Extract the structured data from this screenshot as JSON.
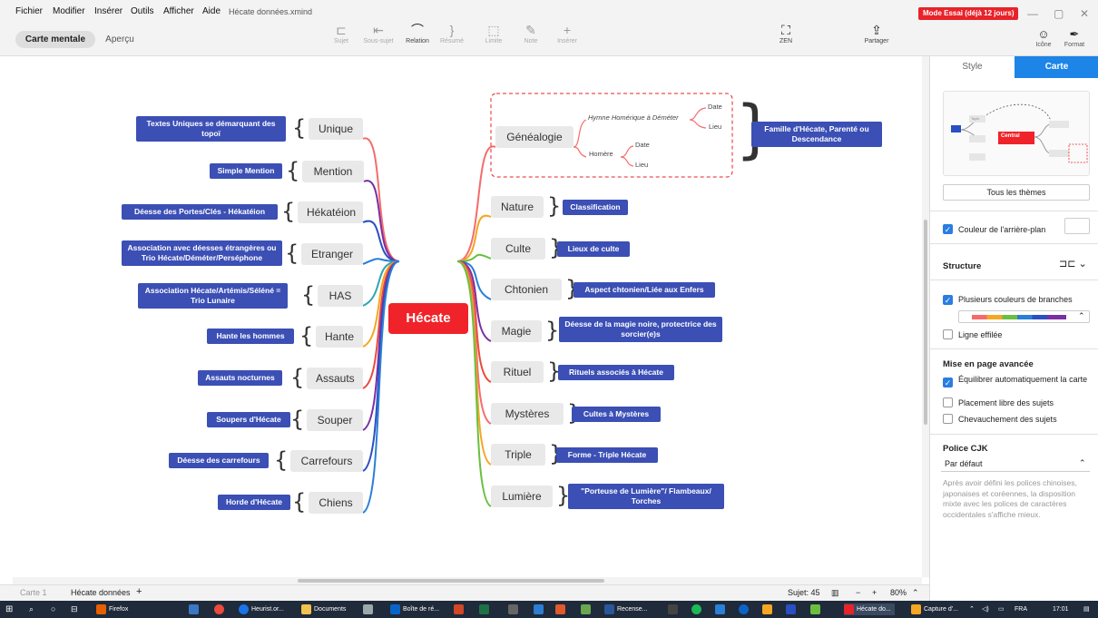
{
  "menubar": {
    "items": [
      "Fichier",
      "Modifier",
      "Insérer",
      "Outils",
      "Afficher",
      "Aide"
    ],
    "filename": "Hécate données.xmind",
    "trial_badge": "Mode Essai (déjà 12 jours)"
  },
  "view_tabs": {
    "mindmap": "Carte mentale",
    "preview": "Aperçu"
  },
  "toolbar": {
    "subject": "Sujet",
    "subsubject": "Sous-sujet",
    "relation": "Relation",
    "summary": "Résumé",
    "boundary": "Limite",
    "note": "Note",
    "insert": "Insérer",
    "zen": "ZEN",
    "share": "Partager",
    "icon_tab": "Icône",
    "format_tab": "Format"
  },
  "map": {
    "central": "Hécate",
    "left_branches": [
      {
        "topic": "Unique",
        "label": "Textes Uniques se démarquant des topoï",
        "color": "#f56b6b"
      },
      {
        "topic": "Mention",
        "label": "Simple Mention",
        "color": "#7b2fa3"
      },
      {
        "topic": "Hékatéion",
        "label": "Déesse des Portes/Clés - Hékatéion",
        "color": "#2a4fc2"
      },
      {
        "topic": "Etranger",
        "label": "Association avec déesses étrangères ou Trio Hécate/Déméter/Perséphone",
        "color": "#2a7fd6"
      },
      {
        "topic": "HAS",
        "label": "Association Hécate/Artémis/Séléné = Trio Lunaire",
        "color": "#2fa6b8"
      },
      {
        "topic": "Hante",
        "label": "Hante les hommes",
        "color": "#f5a623"
      },
      {
        "topic": "Assauts",
        "label": "Assauts nocturnes",
        "color": "#e94b3c"
      },
      {
        "topic": "Souper",
        "label": "Soupers d'Hécate",
        "color": "#7b2fa3"
      },
      {
        "topic": "Carrefours",
        "label": "Déesse des carrefours",
        "color": "#2a4fc2"
      },
      {
        "topic": "Chiens",
        "label": "Horde d'Hécate",
        "color": "#2a7fd6"
      }
    ],
    "right_branches": [
      {
        "topic": "Généalogie",
        "label": "Famille d'Hécate, Parenté ou Descendance",
        "color": "#f56b6b"
      },
      {
        "topic": "Nature",
        "label": "Classification",
        "color": "#f5a623"
      },
      {
        "topic": "Culte",
        "label": "Lieux de culte",
        "color": "#6abf40"
      },
      {
        "topic": "Chtonien",
        "label": "Aspect chtonien/Liée aux Enfers",
        "color": "#2a7fd6"
      },
      {
        "topic": "Magie",
        "label": "Déesse de la magie noire, protectrice des sorcier(e)s",
        "color": "#7b2fa3"
      },
      {
        "topic": "Rituel",
        "label": "Rituels associés à Hécate",
        "color": "#e94b3c"
      },
      {
        "topic": "Mystères",
        "label": "Cultes à Mystères",
        "color": "#f56b6b"
      },
      {
        "topic": "Triple",
        "label": "Forme - Triple Hécate",
        "color": "#f5a623"
      },
      {
        "topic": "Lumière",
        "label": "\"Porteuse de Lumière\"/ Flambeaux/ Torches",
        "color": "#6abf40"
      }
    ],
    "genealogy": {
      "hymn": "Hymne Homérique à Déméter",
      "homer": "Homère",
      "date": "Date",
      "place": "Lieu"
    }
  },
  "sheets": {
    "sheet1": "Carte 1",
    "sheet2": "Hécate données",
    "add": "+"
  },
  "status": {
    "count": "Sujet: 45",
    "zoom": "80%"
  },
  "panel": {
    "tab_style": "Style",
    "tab_map": "Carte",
    "all_themes": "Tous les thèmes",
    "bg_color": "Couleur de l'arrière-plan",
    "structure": "Structure",
    "multi_colors": "Plusieurs couleurs de branches",
    "tapered": "Ligne effilée",
    "advanced": "Mise en page avancée",
    "auto_balance": "Équilibrer automatiquement la carte",
    "free_placement": "Placement libre des sujets",
    "overlap": "Chevauchement des sujets",
    "cjk_font": "Police CJK",
    "cjk_default": "Par défaut",
    "cjk_note": "Après avoir défini les polices chinoises, japonaises et coréennes, la disposition mixte avec les polices de caractères occidentales s'affiche mieux.",
    "thumb_central": "Central",
    "thumb_topic": "Topic",
    "multi_colors_on": true,
    "auto_balance_on": true
  },
  "taskbar": {
    "items": [
      "Firefox",
      "Heurist.or...",
      "Documents",
      "Boîte de ré...",
      "Recense...",
      "Hécate do...",
      "Capture d'..."
    ],
    "lang": "FRA",
    "time": "17:01"
  }
}
